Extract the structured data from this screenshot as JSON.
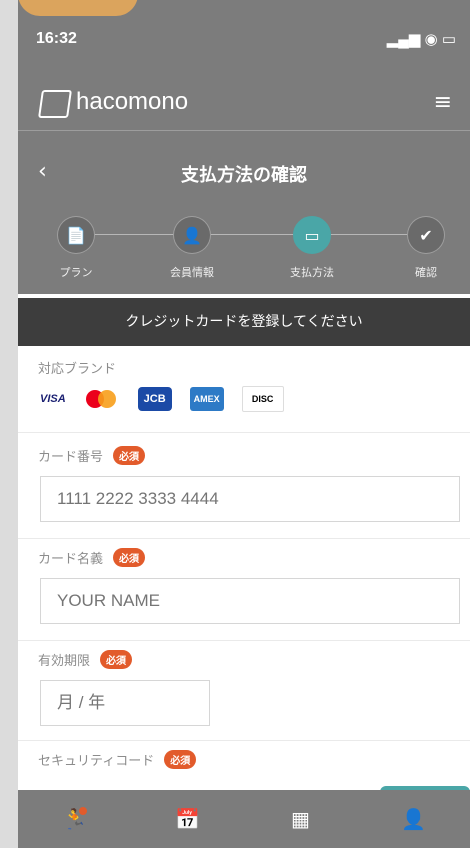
{
  "status_bar": {
    "time": "16:32",
    "icons": "▂▄▆ ◉ ▭"
  },
  "header": {
    "logo_text": "hacomono",
    "menu_label": "≡"
  },
  "title_bar": {
    "back_label": "‹",
    "title": "支払方法の確認"
  },
  "steps": [
    {
      "label": "プラン",
      "icon": "📄",
      "active": false
    },
    {
      "label": "会員情報",
      "icon": "👤",
      "active": false
    },
    {
      "label": "支払方法",
      "icon": "▭",
      "active": true
    },
    {
      "label": "確認",
      "icon": "✔",
      "active": false
    }
  ],
  "banner": {
    "text": "クレジットカードを登録してください"
  },
  "form": {
    "brands_label": "対応ブランド",
    "brands": [
      "VISA",
      "MasterCard",
      "JCB",
      "AMERICAN EXPRESS",
      "DISCOVER"
    ],
    "card_number": {
      "label": "カード番号",
      "required": "必須",
      "placeholder": "1111 2222 3333 4444"
    },
    "card_name": {
      "label": "カード名義",
      "required": "必須",
      "placeholder": "YOUR NAME"
    },
    "expiry": {
      "label": "有効期限",
      "required": "必須",
      "placeholder": "月 / 年"
    },
    "security_code": {
      "label": "セキュリティコード",
      "required": "必須"
    }
  },
  "bottom_nav": {
    "items": [
      {
        "name": "activity-icon",
        "glyph": "🏃"
      },
      {
        "name": "calendar-icon",
        "glyph": "📅"
      },
      {
        "name": "qr-icon",
        "glyph": "▦"
      },
      {
        "name": "account-icon",
        "glyph": "👤"
      }
    ]
  },
  "colors": {
    "accent": "#4aa6a7",
    "required": "#e25b2b",
    "overlay": "#7c7c7c",
    "banner": "#3d3d3d"
  }
}
